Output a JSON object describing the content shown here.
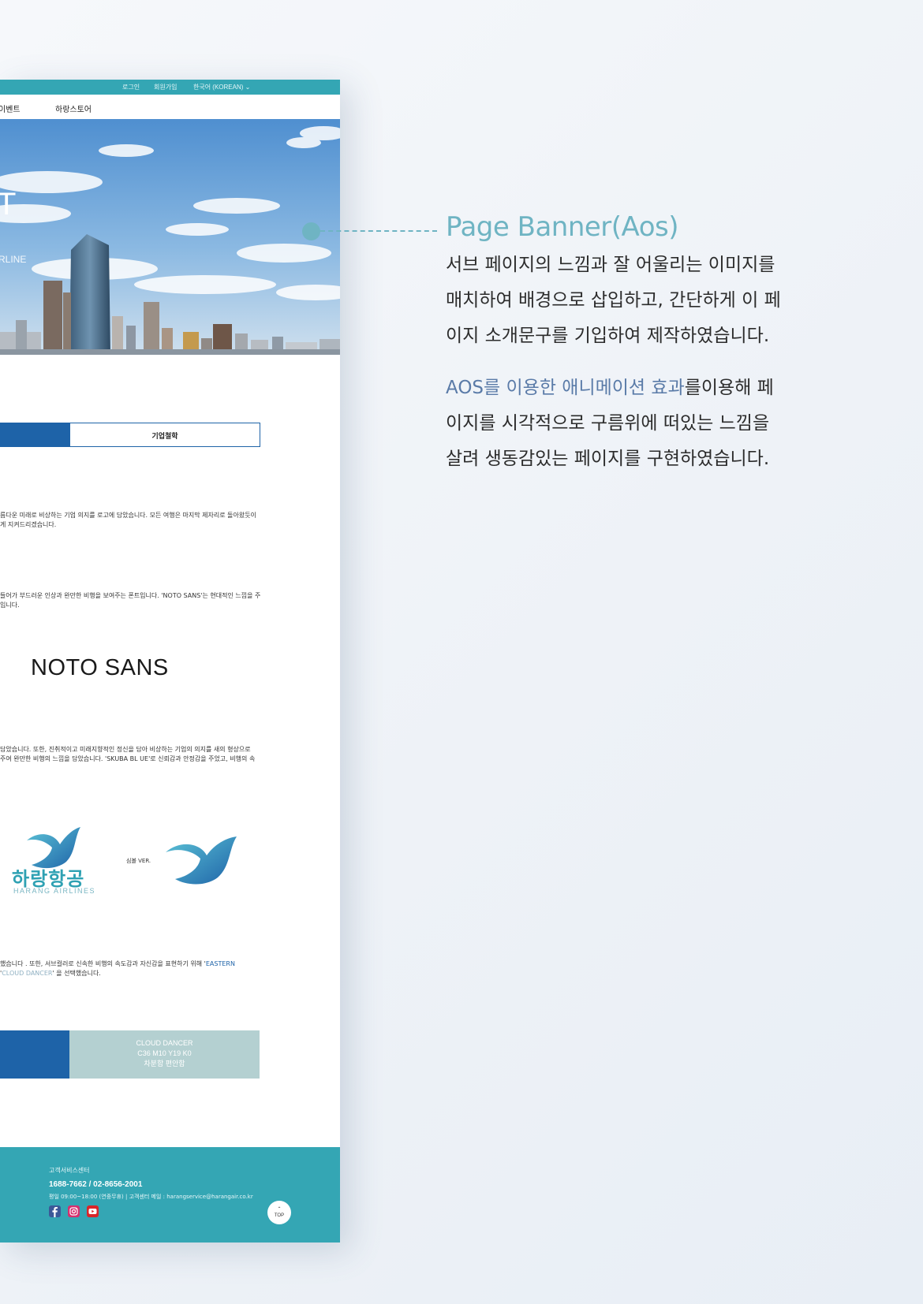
{
  "topbar": {
    "login": "로그인",
    "signup": "회원가입",
    "language": "한국어 (KOREAN)"
  },
  "nav": {
    "items": [
      "이벤트",
      "하랑스토어"
    ]
  },
  "banner": {
    "partial_title": "T",
    "partial_sub": "RLINE"
  },
  "tabs": {
    "inactive_label": "기업철학"
  },
  "paragraphs": {
    "p1_line1": "름다운 미래로 비상하는 기업 의지를 로고에 담았습니다. 모든 여행은 마지막 제자리로 돌아왔듯이",
    "p1_line2": "게 지켜드리겠습니다.",
    "p2_line1": "들어가 부드러운 인상과 완만한 비행을 보여주는 폰트입니다. 'NOTO SANS'는 현대적인 느낌을 주",
    "p2_line2": "입니다.",
    "p3_line1": "담았습니다. 또한, 진취적이고 미래지향적인 정신을 담아 비상하는 기업의 의지를 새의 형상으로",
    "p3_line2": "주여 완만한 비행의 느낌을 담았습니다. 'SKUBA BL UE'로 신뢰감과 안정감을 주었고, 비행의 속",
    "p4_line1_pre": "했습니다 . 또한, 서브컬러로 신속한 비행의 속도감과 자신감을 표현하기 위해 '",
    "p4_line1_hl": "EASTERN",
    "p4_line2_pre": "'",
    "p4_line2_hl": "CLOUD DANCER",
    "p4_line2_post": "' 을 선택했습니다."
  },
  "font_sample": "NOTO SANS",
  "logo": {
    "wordmark": "하랑항공",
    "english": "HARANG AIRLINES",
    "symbol_label": "심볼 VER."
  },
  "swatch": {
    "name": "CLOUD DANCER",
    "cmyk": "C36 M10 Y19 K0",
    "desc": "차분함 편안함"
  },
  "footer": {
    "title": "고객서비스센터",
    "phone": "1688-7662 / 02-8656-2001",
    "hours": "평일 09:00~18:00 (연중무휴) | 고객센터 메일 : harangservice@harangair.co.kr",
    "top_label": "TOP"
  },
  "callout": {
    "title": "Page Banner(Aos)",
    "p1_l1": "서브 페이지의 느낌과 잘 어울리는 이미지를",
    "p1_l2": "매치하여 배경으로 삽입하고, 간단하게 이 페",
    "p1_l3": "이지 소개문구를 기입하여 제작하였습니다.",
    "p2_hl": "AOS를 이용한  애니메이션 효과",
    "p2_l1_post": "를이용해 페",
    "p2_l2": "이지를 시각적으로 구름위에 떠있는 느낌을",
    "p2_l3": "살려 생동감있는 페이지를 구현하였습니다."
  },
  "colors": {
    "teal": "#34a6b4",
    "primary_blue": "#1e63a8",
    "cloud_dancer": "#b4d0d1",
    "callout_accent": "#6fb4c3"
  }
}
